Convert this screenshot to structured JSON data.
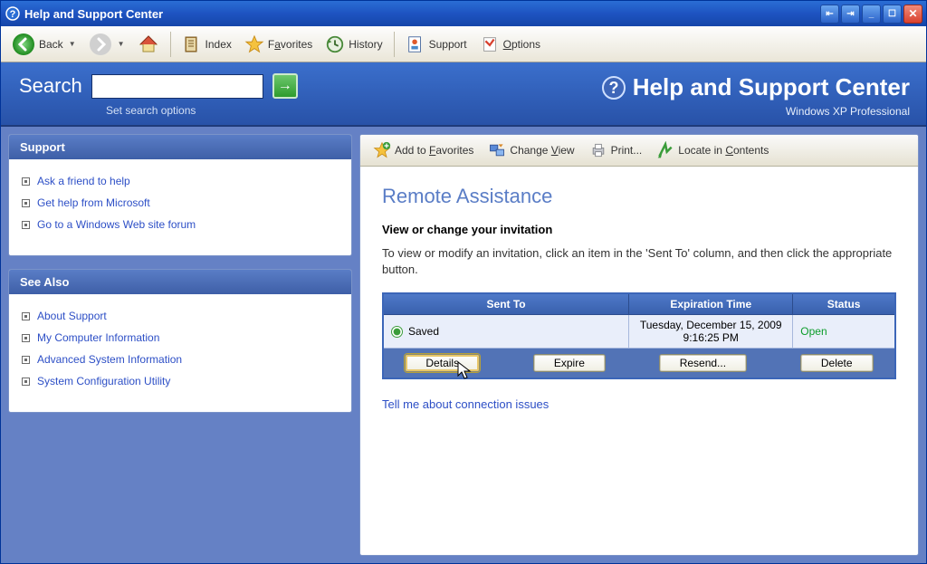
{
  "window": {
    "title": "Help and Support Center"
  },
  "toolbar": {
    "back": "Back",
    "index": "Index",
    "favorites": "Favorites",
    "history": "History",
    "support": "Support",
    "options": "Options"
  },
  "search": {
    "label": "Search",
    "value": "",
    "set_options": "Set search options"
  },
  "header": {
    "title": "Help and Support Center",
    "product": "Windows XP Professional"
  },
  "sidebar": {
    "support": {
      "title": "Support",
      "items": [
        "Ask a friend to help",
        "Get help from Microsoft",
        "Go to a Windows Web site forum"
      ]
    },
    "seealso": {
      "title": "See Also",
      "items": [
        "About Support",
        "My Computer Information",
        "Advanced System Information",
        "System Configuration Utility"
      ]
    }
  },
  "content_toolbar": {
    "add_fav": "Add to Favorites",
    "change_view": "Change View",
    "print": "Print...",
    "locate": "Locate in Contents"
  },
  "content": {
    "heading": "Remote Assistance",
    "subheading": "View or change your invitation",
    "body": "To view or modify an invitation, click an item in the 'Sent To' column, and then click the appropriate button.",
    "table": {
      "headers": {
        "sent_to": "Sent To",
        "exp": "Expiration Time",
        "status": "Status"
      },
      "row": {
        "sent_to": "Saved",
        "exp": "Tuesday, December 15, 2009 9:16:25 PM",
        "status": "Open"
      },
      "buttons": {
        "details": "Details",
        "expire": "Expire",
        "resend": "Resend...",
        "delete": "Delete"
      }
    },
    "footer_link": "Tell me about connection issues"
  }
}
